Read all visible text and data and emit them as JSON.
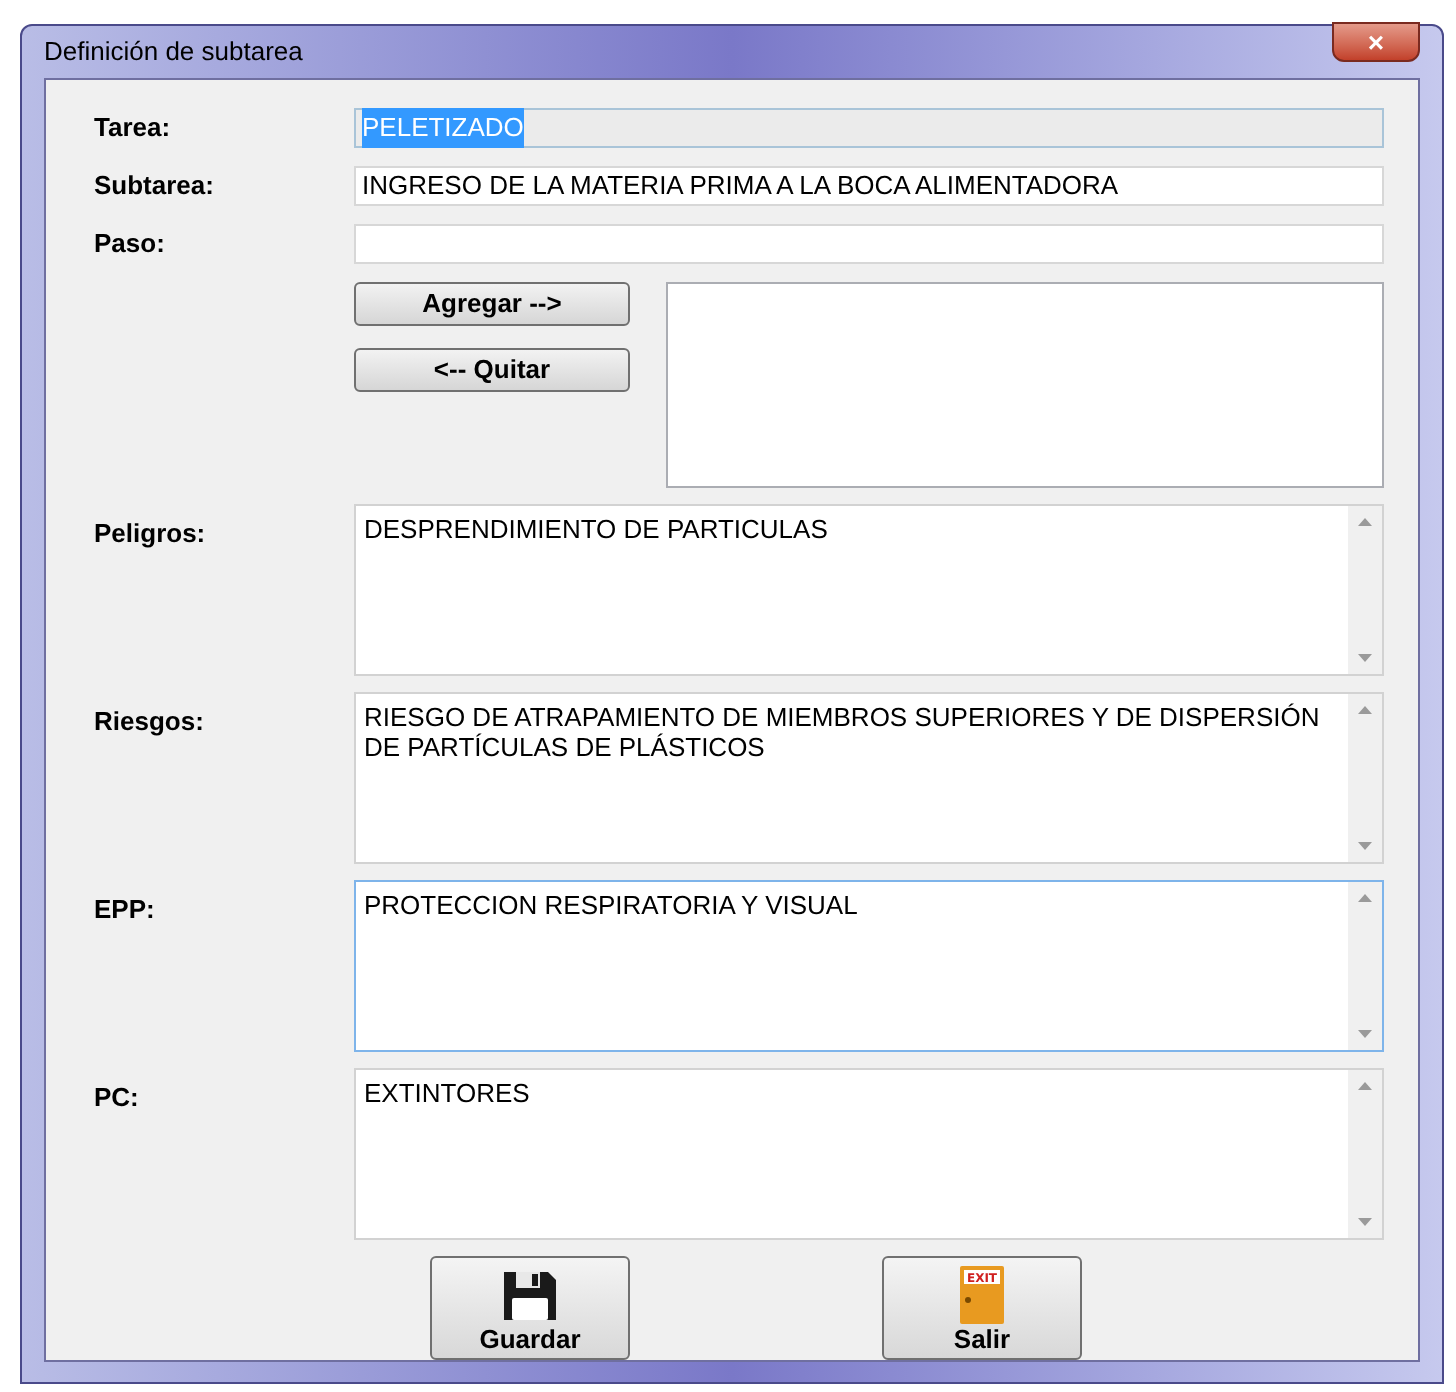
{
  "window": {
    "title": "Definición de subtarea",
    "close": "×"
  },
  "fields": [
    {
      "label": "Tarea:",
      "value": "PELETIZADO",
      "disabled": true,
      "text_selected": true
    },
    {
      "label": "Subtarea:",
      "value": "INGRESO DE LA MATERIA PRIMA A LA BOCA ALIMENTADORA",
      "disabled": false
    },
    {
      "label": "Paso:",
      "disabled": false
    }
  ],
  "step_buttons": [
    "Agregar -->",
    "<-- Quitar"
  ],
  "text_areas": [
    {
      "label": "Peligros:",
      "value": "DESPRENDIMIENTO DE PARTICULAS",
      "focused": false
    },
    {
      "label": "Riesgos:",
      "value": "RIESGO DE ATRAPAMIENTO DE MIEMBROS SUPERIORES Y DE DISPERSIÓN DE PARTÍCULAS DE PLÁSTICOS",
      "focused": false
    },
    {
      "label": "EPP:",
      "value": "PROTECCION RESPIRATORIA Y VISUAL",
      "focused": true
    },
    {
      "label": "PC:",
      "value": "EXTINTORES",
      "focused": false
    }
  ],
  "actions": [
    {
      "kind": "save",
      "label": "Guardar"
    },
    {
      "kind": "exit",
      "label": "Salir",
      "sign": "EXIT"
    }
  ]
}
